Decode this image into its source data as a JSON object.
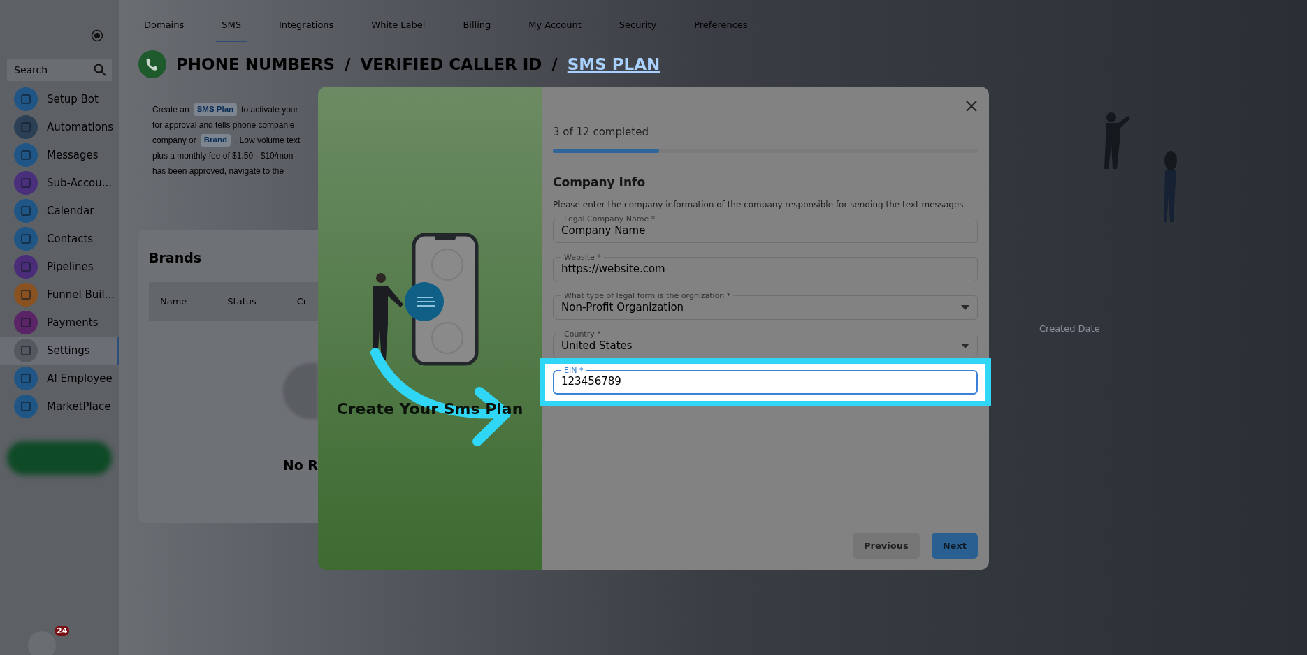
{
  "sidebar": {
    "search_placeholder": "Search",
    "items": [
      {
        "label": "Setup Bot",
        "color": "#1f5686",
        "selected": false
      },
      {
        "label": "Automations",
        "color": "#2b3f55",
        "selected": false
      },
      {
        "label": "Messages",
        "color": "#1f5686",
        "selected": false
      },
      {
        "label": "Sub-Accou...",
        "color": "#4a2f7c",
        "selected": false
      },
      {
        "label": "Calendar",
        "color": "#1f5686",
        "selected": false
      },
      {
        "label": "Contacts",
        "color": "#1f5686",
        "selected": false
      },
      {
        "label": "Pipelines",
        "color": "#4b2c78",
        "selected": false
      },
      {
        "label": "Funnel Buil...",
        "color": "#8a5220",
        "selected": false
      },
      {
        "label": "Payments",
        "color": "#5a2466",
        "selected": false
      },
      {
        "label": "Settings",
        "color": "#55595f",
        "selected": true
      },
      {
        "label": "AI Employee",
        "color": "#1f5686",
        "selected": false
      },
      {
        "label": "MarketPlace",
        "color": "#1f5686",
        "selected": false
      }
    ],
    "notification_count": "24"
  },
  "top_tabs": [
    {
      "label": "Domains",
      "selected": false
    },
    {
      "label": "SMS",
      "selected": true
    },
    {
      "label": "Integrations",
      "selected": false
    },
    {
      "label": "White Label",
      "selected": false
    },
    {
      "label": "Billing",
      "selected": false
    },
    {
      "label": "My Account",
      "selected": false
    },
    {
      "label": "Security",
      "selected": false
    },
    {
      "label": "Preferences",
      "selected": false
    }
  ],
  "breadcrumb": {
    "items": [
      {
        "label": "PHONE NUMBERS",
        "selected": false
      },
      {
        "label": "VERIFIED CALLER ID",
        "selected": false
      },
      {
        "label": "SMS PLAN",
        "selected": true
      }
    ],
    "separator": "/"
  },
  "description_lines": [
    [
      {
        "kind": "text",
        "text": "Create an"
      },
      {
        "kind": "chip",
        "text": "SMS Plan"
      },
      {
        "kind": "text",
        "text": "to activate your"
      }
    ],
    [
      {
        "kind": "text",
        "text": "for approval and tells phone companie"
      }
    ],
    [
      {
        "kind": "text",
        "text": "company or"
      },
      {
        "kind": "chip",
        "text": "Brand"
      },
      {
        "kind": "text",
        "text": ". Low volume text"
      }
    ],
    [
      {
        "kind": "text",
        "text": "plus a monthly fee of $1.50 - $10/mon"
      }
    ],
    [
      {
        "kind": "text",
        "text": "has been approved, navigate to the"
      }
    ]
  ],
  "brands": {
    "title": "Brands",
    "columns": [
      "Name",
      "Status",
      "Cr"
    ],
    "empty_text": "No R"
  },
  "background_table": {
    "column": "Created Date"
  },
  "modal": {
    "illustration_title": "Create Your Sms Plan",
    "progress": {
      "text": "3 of 12 completed",
      "level": 0.25
    },
    "section_title": "Company Info",
    "section_description": "Please enter the company information of the company responsible for sending the text messages",
    "fields": [
      {
        "kind": "text",
        "label": "Legal Company Name *",
        "value": "Company Name",
        "focused": false
      },
      {
        "kind": "text",
        "label": "Website *",
        "value": "https://website.com",
        "focused": false
      },
      {
        "kind": "select",
        "label": "What type of legal form is the orgnization *",
        "value": "Non-Profit Organization",
        "focused": false
      },
      {
        "kind": "select",
        "label": "Country *",
        "value": "United States",
        "focused": false
      },
      {
        "kind": "text",
        "label": "EIN *",
        "value": "123456789",
        "focused": true
      }
    ],
    "buttons": [
      {
        "label": "Previous",
        "kind": "secondary"
      },
      {
        "label": "Next",
        "kind": "primary"
      }
    ]
  }
}
